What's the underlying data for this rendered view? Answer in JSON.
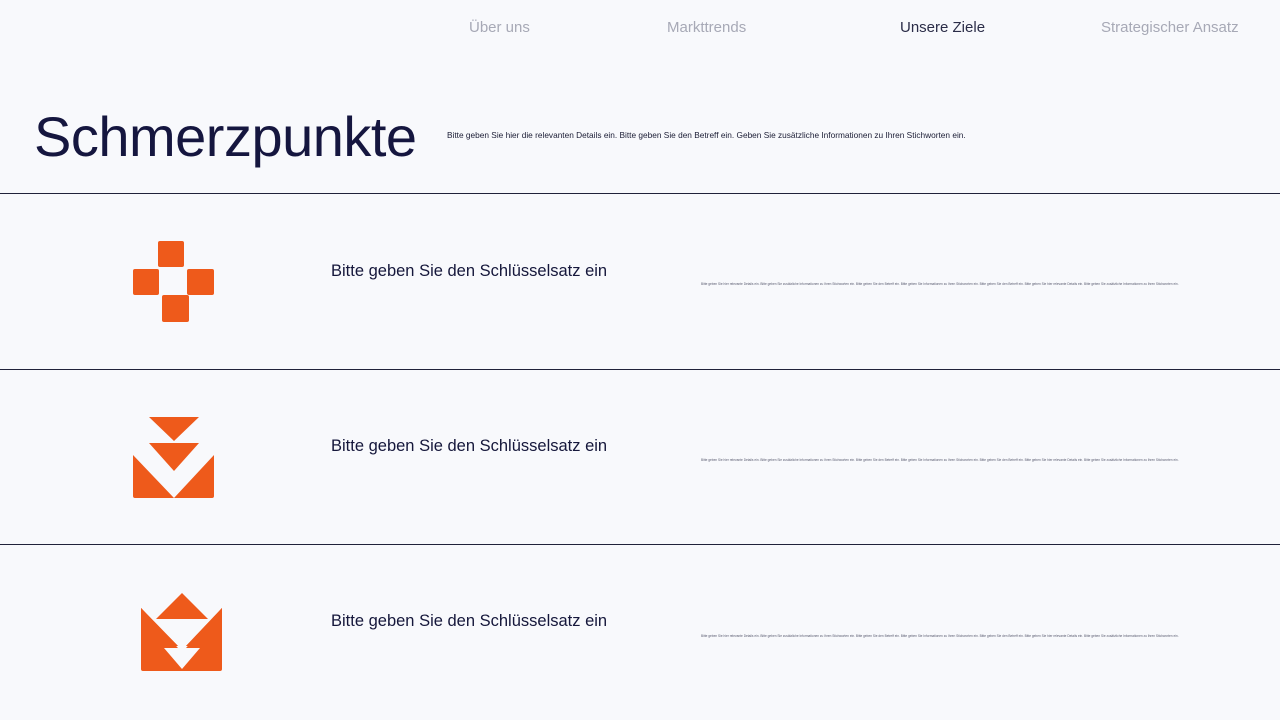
{
  "nav": {
    "items": [
      {
        "label": "Über uns",
        "active": false
      },
      {
        "label": "Markttrends",
        "active": false
      },
      {
        "label": "Unsere Ziele",
        "active": true
      },
      {
        "label": "Strategischer Ansatz",
        "active": false
      }
    ]
  },
  "header": {
    "title": "Schmerzpunkte",
    "intro": "Bitte geben Sie hier die relevanten Details ein. Bitte geben Sie den Betreff ein. Geben Sie zusätzliche Informationen zu Ihren Stichworten ein."
  },
  "rows": [
    {
      "icon": "pixel-cross-icon",
      "keyphrase": "Bitte geben Sie den Schlüsselsatz ein",
      "details": "Bitte geben Sie hier relevante Details ein. Bitte geben Sie zusätzliche Informationen zu Ihren Stichworten ein. Bitte geben Sie den Betreff ein. Bitte geben Sie Informationen zu Ihren Stichworten ein. Bitte geben Sie den Betreff ein. Bitte geben Sie hier relevante Details ein. Bitte geben Sie zusätzliche Informationen zu Ihren Stichworten ein."
    },
    {
      "icon": "download-arrows-icon",
      "keyphrase": "Bitte geben Sie den Schlüsselsatz ein",
      "details": "Bitte geben Sie hier relevante Details ein. Bitte geben Sie zusätzliche Informationen zu Ihren Stichworten ein. Bitte geben Sie den Betreff ein. Bitte geben Sie Informationen zu Ihren Stichworten ein. Bitte geben Sie den Betreff ein. Bitte geben Sie hier relevante Details ein. Bitte geben Sie zusätzliche Informationen zu Ihren Stichworten ein."
    },
    {
      "icon": "envelope-arrows-icon",
      "keyphrase": "Bitte geben Sie den Schlüsselsatz ein",
      "details": "Bitte geben Sie hier relevante Details ein. Bitte geben Sie zusätzliche Informationen zu Ihren Stichworten ein. Bitte geben Sie den Betreff ein. Bitte geben Sie Informationen zu Ihren Stichworten ein. Bitte geben Sie den Betreff ein. Bitte geben Sie hier relevante Details ein. Bitte geben Sie zusätzliche Informationen zu Ihren Stichworten ein."
    }
  ],
  "colors": {
    "accent": "#ee5a1b",
    "title": "#15163f",
    "background": "#f8f9fc",
    "nav_inactive": "#a7a9b6",
    "nav_active": "#2b2d48",
    "divider": "#20223a"
  }
}
